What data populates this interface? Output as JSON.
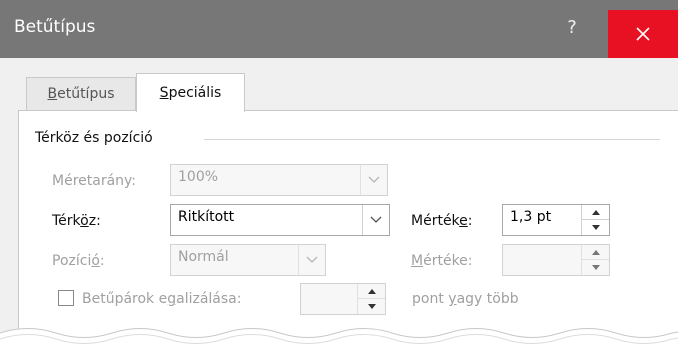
{
  "window": {
    "title": "Betűtípus",
    "help_label": "?",
    "close_icon": "close-icon"
  },
  "tabs": [
    {
      "label_pre": "",
      "label_u": "B",
      "label_post": "etűtípus",
      "active": false
    },
    {
      "label_pre": "",
      "label_u": "S",
      "label_post": "peciális",
      "active": true
    }
  ],
  "group": {
    "title": "Térköz és pozíció"
  },
  "scale": {
    "label": "Méretarány:",
    "value": "100%",
    "enabled": false
  },
  "spacing": {
    "label_pre": "Térk",
    "label_u": "ö",
    "label_post": "z:",
    "value": "Ritkított",
    "amount_label_pre": "Mértéke",
    "amount_label_u": "k",
    "amount_label_post": ":",
    "amount_label_rest": "e:",
    "amount_value": "1,3 pt"
  },
  "position": {
    "label_pre": "Pozíci",
    "label_u": "ó",
    "label_post": ":",
    "value": "Normál",
    "amount_label_pre": "",
    "amount_label_u": "M",
    "amount_label_post": "értéke:",
    "amount_value": "",
    "enabled": false
  },
  "kerning": {
    "label_pre": "Betűpárok e",
    "label_u": "g",
    "label_post": "alizálása:",
    "value": "",
    "suffix_pre": "pont ",
    "suffix_u": "y",
    "suffix_post": "agy több",
    "checked": false,
    "enabled": false
  },
  "colors": {
    "titlebar": "#777777",
    "close": "#e81123",
    "disabled_text": "#a0a0a0"
  }
}
